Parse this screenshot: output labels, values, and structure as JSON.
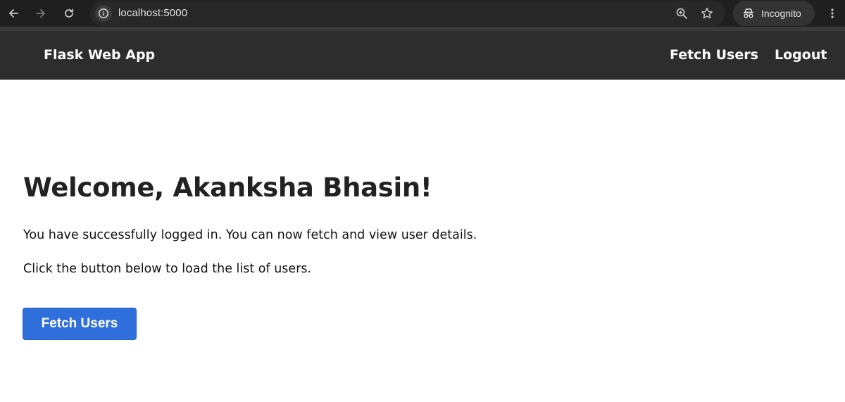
{
  "browser": {
    "url": "localhost:5000",
    "profile_label": "Incognito",
    "icons": [
      "back-icon",
      "forward-icon",
      "reload-icon",
      "site-info-icon",
      "zoom-icon",
      "bookmark-star-icon",
      "incognito-icon",
      "more-menu-icon"
    ]
  },
  "navbar": {
    "brand": "Flask Web App",
    "links": [
      "Fetch Users",
      "Logout"
    ],
    "background": "#2d2d2d"
  },
  "main": {
    "heading": "Welcome, Akanksha Bhasin!",
    "paragraph1": "You have successfully logged in. You can now fetch and view user details.",
    "paragraph2": "Click the button below to load the list of users.",
    "button_label": "Fetch Users",
    "button_color": "#2f6fdc"
  }
}
